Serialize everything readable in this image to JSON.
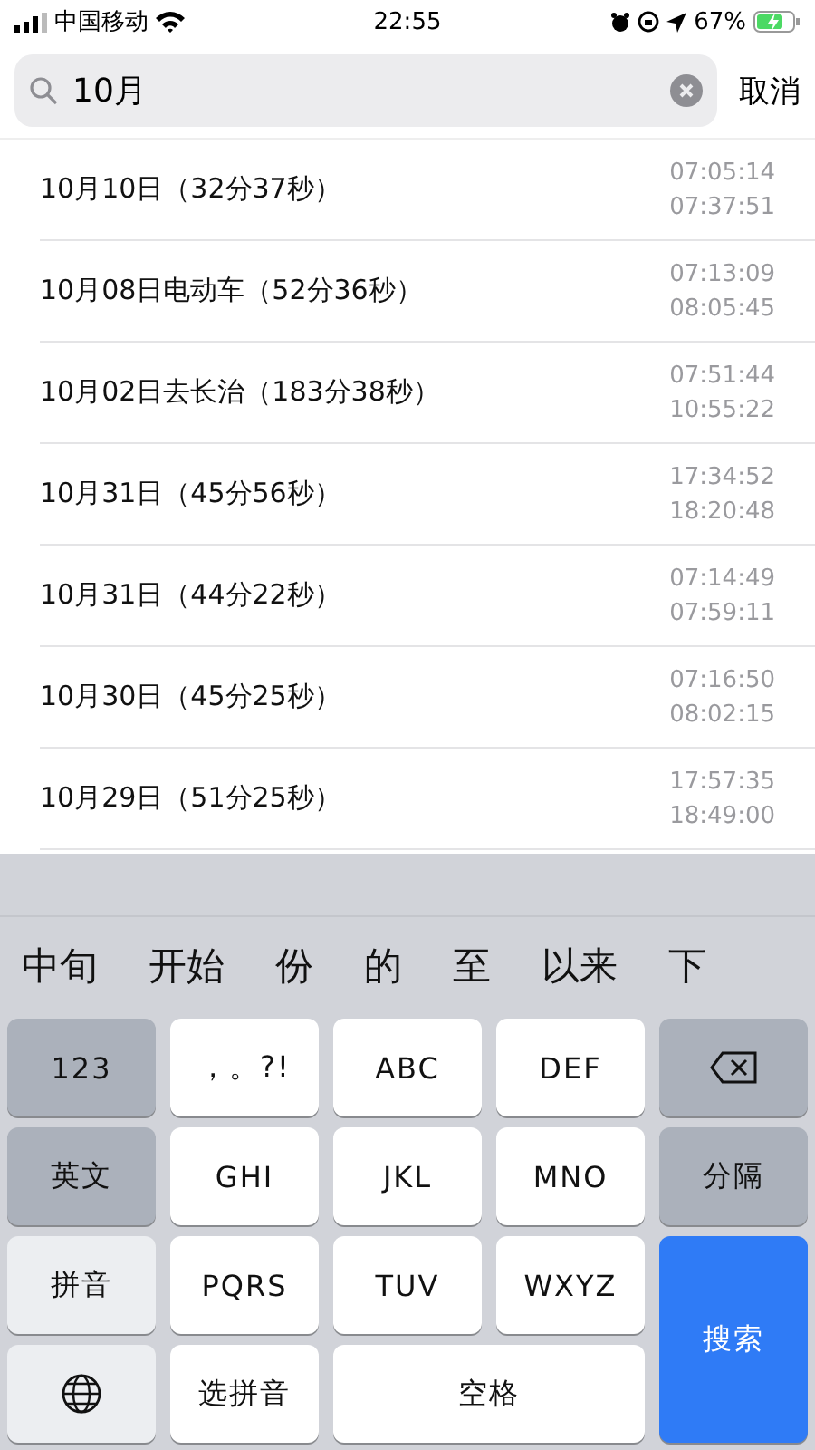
{
  "status_bar": {
    "carrier": "中国移动",
    "time": "22:55",
    "battery": "67%"
  },
  "search": {
    "value": "10月",
    "cancel": "取消"
  },
  "rows": [
    {
      "title": "10月10日（32分37秒）",
      "start": "07:05:14",
      "end": "07:37:51"
    },
    {
      "title": "10月08日电动车（52分36秒）",
      "start": "07:13:09",
      "end": "08:05:45"
    },
    {
      "title": "10月02日去长治（183分38秒）",
      "start": "07:51:44",
      "end": "10:55:22"
    },
    {
      "title": "10月31日（45分56秒）",
      "start": "17:34:52",
      "end": "18:20:48"
    },
    {
      "title": "10月31日（44分22秒）",
      "start": "07:14:49",
      "end": "07:59:11"
    },
    {
      "title": "10月30日（45分25秒）",
      "start": "07:16:50",
      "end": "08:02:15"
    },
    {
      "title": "10月29日（51分25秒）",
      "start": "17:57:35",
      "end": "18:49:00"
    }
  ],
  "candidates": [
    "中旬",
    "开始",
    "份",
    "的",
    "至",
    "以来",
    "下"
  ],
  "keys": [
    {
      "kind": "function",
      "label": "123"
    },
    {
      "kind": "letter",
      "label": "，。?!"
    },
    {
      "kind": "letter",
      "label": "ABC"
    },
    {
      "kind": "letter",
      "label": "DEF"
    },
    {
      "kind": "delete"
    },
    {
      "kind": "function",
      "label": "英文"
    },
    {
      "kind": "letter",
      "label": "GHI"
    },
    {
      "kind": "letter",
      "label": "JKL"
    },
    {
      "kind": "letter",
      "label": "MNO"
    },
    {
      "kind": "function",
      "label": "分隔"
    },
    {
      "kind": "mode",
      "label": "拼音"
    },
    {
      "kind": "letter",
      "label": "PQRS"
    },
    {
      "kind": "letter",
      "label": "TUV"
    },
    {
      "kind": "letter",
      "label": "WXYZ"
    },
    {
      "kind": "search",
      "label": "搜索"
    },
    {
      "kind": "globe"
    },
    {
      "kind": "letter",
      "label": "选拼音"
    },
    {
      "kind": "space",
      "label": "空格"
    }
  ]
}
